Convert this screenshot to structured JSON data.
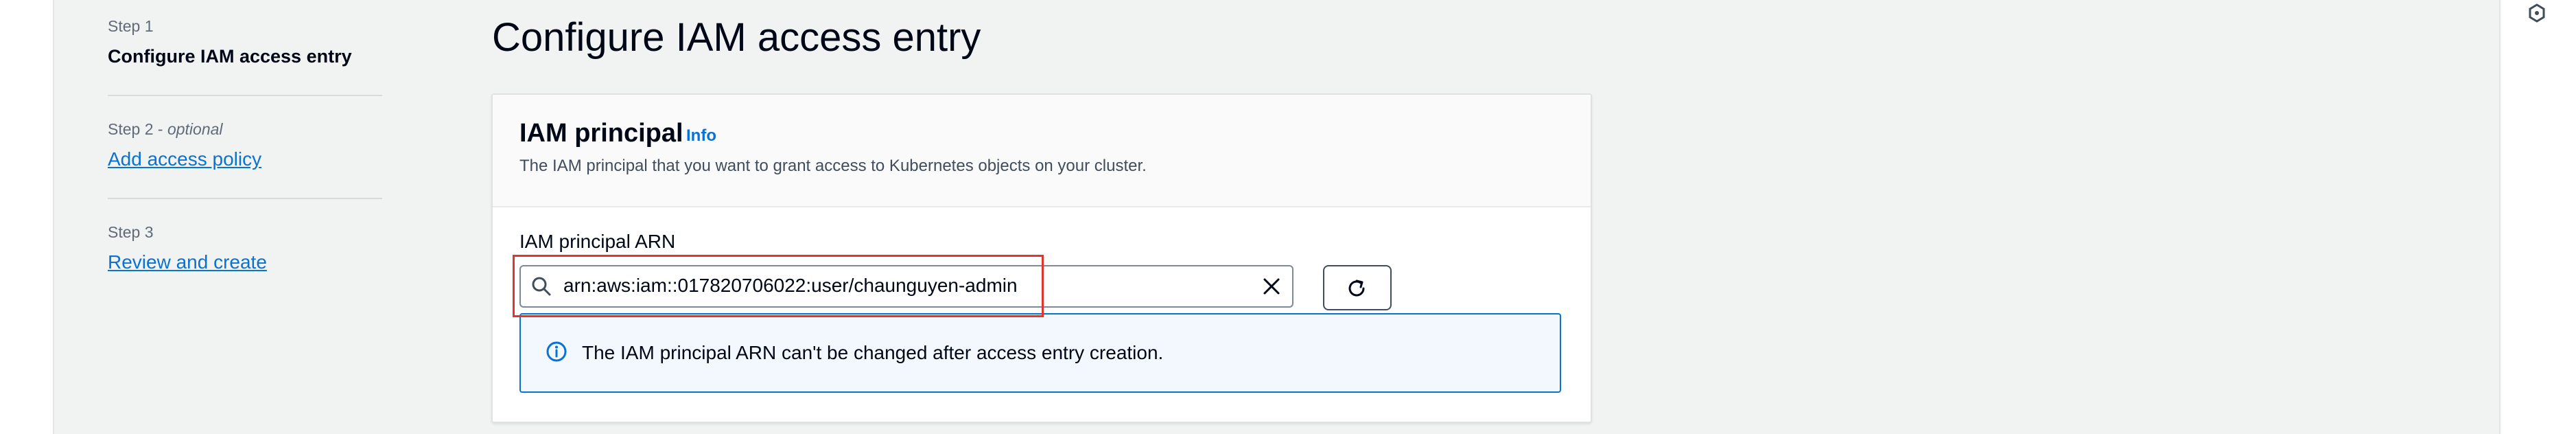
{
  "steps": [
    {
      "number": "Step 1",
      "title": "Configure IAM access entry"
    },
    {
      "number": "Step 2",
      "optional": "optional",
      "title": "Add access policy"
    },
    {
      "number": "Step 3",
      "title": "Review and create"
    }
  ],
  "page": {
    "title": "Configure IAM access entry"
  },
  "card": {
    "title": "IAM principal",
    "info_label": "Info",
    "description": "The IAM principal that you want to grant access to Kubernetes objects on your cluster."
  },
  "field": {
    "label": "IAM principal ARN",
    "value": "arn:aws:iam::017820706022:user/chaunguyen-admin"
  },
  "alert": {
    "text": "The IAM principal ARN can't be changed after access entry creation."
  },
  "icons": {
    "search": "search-icon",
    "clear": "close-icon",
    "refresh": "refresh-icon",
    "info": "info-icon",
    "utility": "hexagon-icon"
  },
  "colors": {
    "link": "#0972d3",
    "highlight": "#e0362f",
    "alert_bg": "#f2f8fd"
  }
}
